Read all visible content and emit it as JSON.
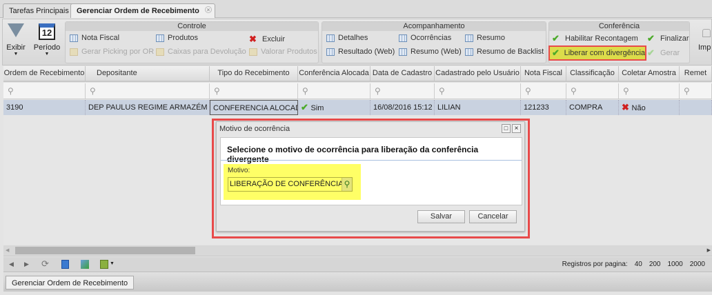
{
  "tabs": [
    {
      "label": "Tarefas Principais"
    },
    {
      "label": "Gerenciar Ordem de Recebimento"
    }
  ],
  "toolbar": {
    "exibir": "Exibir",
    "periodo": "Período",
    "calendar_day": "12",
    "controle": {
      "title": "Controle",
      "items": [
        "Nota Fiscal",
        "Produtos",
        "Excluir",
        "Gerar Picking por OR",
        "Caixas para Devolução",
        "Valorar Produtos"
      ]
    },
    "acompanhamento": {
      "title": "Acompanhamento",
      "items": [
        "Detalhes",
        "Ocorrências",
        "Resumo",
        "Resultado (Web)",
        "Resumo (Web)",
        "Resumo de Backlist"
      ]
    },
    "conferencia": {
      "title": "Conferência",
      "items": [
        "Habilitar Recontagem",
        "Finalizar",
        "Liberar com divergência",
        "Gerar"
      ]
    },
    "imp": "Imp"
  },
  "grid": {
    "columns": [
      "Ordem de Recebimento",
      "Depositante",
      "Tipo do Recebimento",
      "Conferência Alocada",
      "Data de Cadastro",
      "Cadastrado pelo Usuário",
      "Nota Fiscal",
      "Classificação",
      "Coletar Amostra",
      "Remet"
    ],
    "rows": [
      [
        "3190",
        "DEP PAULUS REGIME ARMAZÉM G...",
        "CONFERENCIA ALOCADA",
        "Sim",
        "16/08/2016 15:12",
        "LILIAN",
        "121233",
        "COMPRA",
        "Não",
        ""
      ]
    ]
  },
  "dialog": {
    "title": "Motivo de ocorrência",
    "heading": "Selecione o motivo de ocorrência para liberação da conferência divergente",
    "field_label": "Motivo:",
    "field_value": "LIBERAÇÃO DE CONFERÊNCIA CO",
    "save": "Salvar",
    "cancel": "Cancelar"
  },
  "pager": {
    "label": "Registros por pagina:",
    "sizes": [
      "40",
      "200",
      "1000",
      "2000"
    ]
  },
  "bottom_tab": "Gerenciar Ordem de Recebimento",
  "colors": {
    "highlight": "#ffff66",
    "annotation": "#e84a4a",
    "row_selected": "#c9d2e0"
  }
}
